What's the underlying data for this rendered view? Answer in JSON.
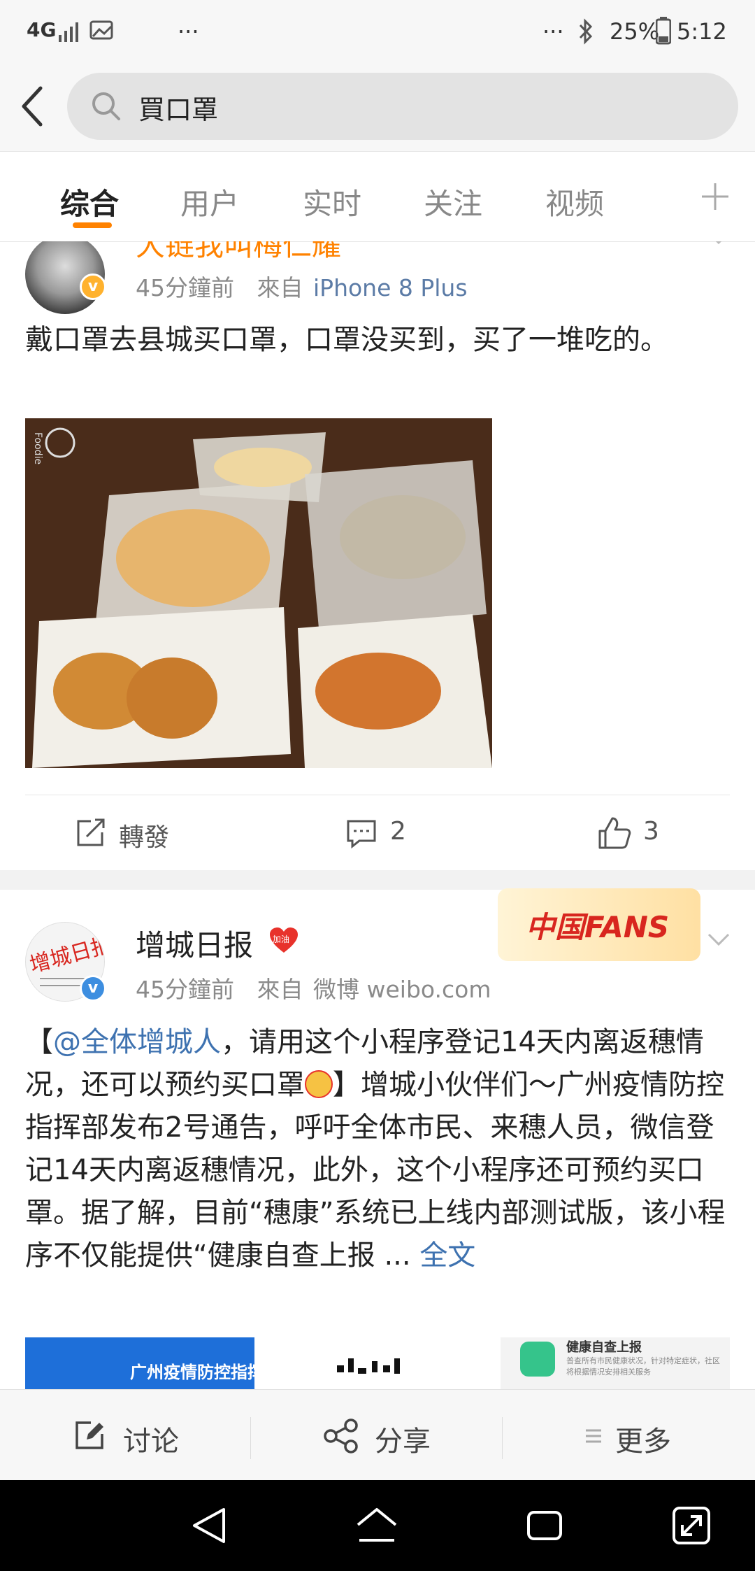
{
  "status_bar": {
    "network": "4G",
    "icons": [
      "signal-icon",
      "image-icon"
    ],
    "more_left": "···",
    "more_right": "···",
    "battery": "25%",
    "time": "5:12"
  },
  "search": {
    "query": "買口罩"
  },
  "tabs": [
    {
      "label": "综合",
      "active": true
    },
    {
      "label": "用户",
      "active": false
    },
    {
      "label": "实时",
      "active": false
    },
    {
      "label": "关注",
      "active": false
    },
    {
      "label": "视频",
      "active": false
    }
  ],
  "post1": {
    "author": "大链我叫梅仁耀",
    "time": "45分鐘前",
    "from_label": "來自",
    "source": "iPhone 8 Plus",
    "text": "戴口罩去县城买口罩，口罩没买到，买了一堆吃的。",
    "image_label": "Foodie",
    "actions": {
      "repost": "轉發",
      "comments": "2",
      "likes": "3"
    }
  },
  "post2": {
    "author": "增城日报",
    "badge": "加油",
    "banner": "中国FANS",
    "time": "45分鐘前",
    "from_label": "來自",
    "source": "微博 weibo.com",
    "mention": "@全体增城人",
    "text_before": "【",
    "text_after": "，请用这个小程序登记14天内离返穗情况，还可以预约买口罩",
    "text_rest": "】增城小伙伴们～广州疫情防控指挥部发布2号通告，呼吁全体市民、来穗人员，微信登记14天内离返穗情况，此外，这个小程序还可预约买口罩。据了解，目前“穗康”系统已上线内部测试版，该小程序不仅能提供“健康自查上报",
    "ellipsis": " ... ",
    "full_text": "全文",
    "thumb1": "广州疫情防控指挥",
    "thumb3_title": "健康自查上报",
    "thumb3_sub": "普查所有市民健康状况，针对特定症状，社区将根据情况安排相关服务"
  },
  "bottom_bar": {
    "discuss": "讨论",
    "share": "分享",
    "more": "更多"
  },
  "colors": {
    "accent": "#ff8200",
    "link": "#3e72b0"
  }
}
